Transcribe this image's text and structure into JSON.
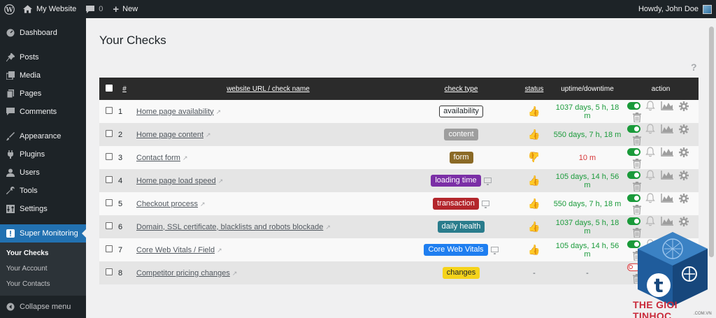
{
  "adminbar": {
    "site_name": "My Website",
    "comments_count": "0",
    "new_label": "New",
    "howdy": "Howdy, John Doe"
  },
  "sidebar": {
    "items": [
      {
        "label": "Dashboard",
        "icon": "dashboard-icon"
      },
      {
        "label": "Posts",
        "icon": "pin-icon"
      },
      {
        "label": "Media",
        "icon": "media-icon"
      },
      {
        "label": "Pages",
        "icon": "pages-icon"
      },
      {
        "label": "Comments",
        "icon": "comment-icon"
      },
      {
        "label": "Appearance",
        "icon": "brush-icon"
      },
      {
        "label": "Plugins",
        "icon": "plug-icon"
      },
      {
        "label": "Users",
        "icon": "user-icon"
      },
      {
        "label": "Tools",
        "icon": "wrench-icon"
      },
      {
        "label": "Settings",
        "icon": "settings-icon"
      },
      {
        "label": "Super Monitoring",
        "icon": "alert-icon"
      }
    ],
    "submenu": [
      "Your Checks",
      "Your Account",
      "Your Contacts"
    ],
    "collapse": "Collapse menu"
  },
  "main": {
    "title": "Your Checks",
    "help": "?",
    "table": {
      "headers": {
        "num": "#",
        "name": "website URL / check name",
        "type": "check type",
        "status": "status",
        "uptime": "uptime/downtime",
        "action": "action"
      },
      "rows": [
        {
          "num": "1",
          "name": "Home page availability",
          "type": "availability",
          "type_color": "#ffffff",
          "status": "up",
          "uptime": "1037 days, 5 h, 18 m",
          "uptime_state": "up",
          "enabled": true
        },
        {
          "num": "2",
          "name": "Home page content",
          "type": "content",
          "type_color": "#9e9e9e",
          "status": "up",
          "uptime": "550 days, 7 h, 18 m",
          "uptime_state": "up",
          "enabled": true
        },
        {
          "num": "3",
          "name": "Contact form",
          "type": "form",
          "type_color": "#8b6a26",
          "status": "down",
          "uptime": "10 m",
          "uptime_state": "down",
          "enabled": true
        },
        {
          "num": "4",
          "name": "Home page load speed",
          "type": "loading time",
          "type_color": "#7b2fa6",
          "status": "up",
          "uptime": "105 days, 14 h, 56 m",
          "uptime_state": "up",
          "enabled": true,
          "monitor": true
        },
        {
          "num": "5",
          "name": "Checkout process",
          "type": "transaction",
          "type_color": "#b3262c",
          "status": "up",
          "uptime": "550 days, 7 h, 18 m",
          "uptime_state": "up",
          "enabled": true,
          "monitor": true
        },
        {
          "num": "6",
          "name": "Domain, SSL certificate, blacklists and robots blockade",
          "type": "daily health",
          "type_color": "#2a7c8c",
          "status": "up",
          "uptime": "1037 days, 5 h, 18 m",
          "uptime_state": "up",
          "enabled": true
        },
        {
          "num": "7",
          "name": "Core Web Vitals / Field",
          "type": "Core Web Vitals",
          "type_color": "#1e7ef0",
          "status": "up",
          "uptime": "105 days, 14 h, 56 m",
          "uptime_state": "up",
          "enabled": true,
          "monitor": true
        },
        {
          "num": "8",
          "name": "Competitor pricing changes",
          "type": "changes",
          "type_color": "#f5d31b",
          "status": "-",
          "uptime": "-",
          "uptime_state": "none",
          "enabled": false
        }
      ]
    }
  },
  "watermark": {
    "text": "THE GIOI TINHOC",
    "sub": ".COM.VN"
  },
  "colors": {
    "admin_dark": "#1d2327",
    "accent": "#2271b1",
    "up": "#1a9a3a",
    "down": "#d63638"
  }
}
